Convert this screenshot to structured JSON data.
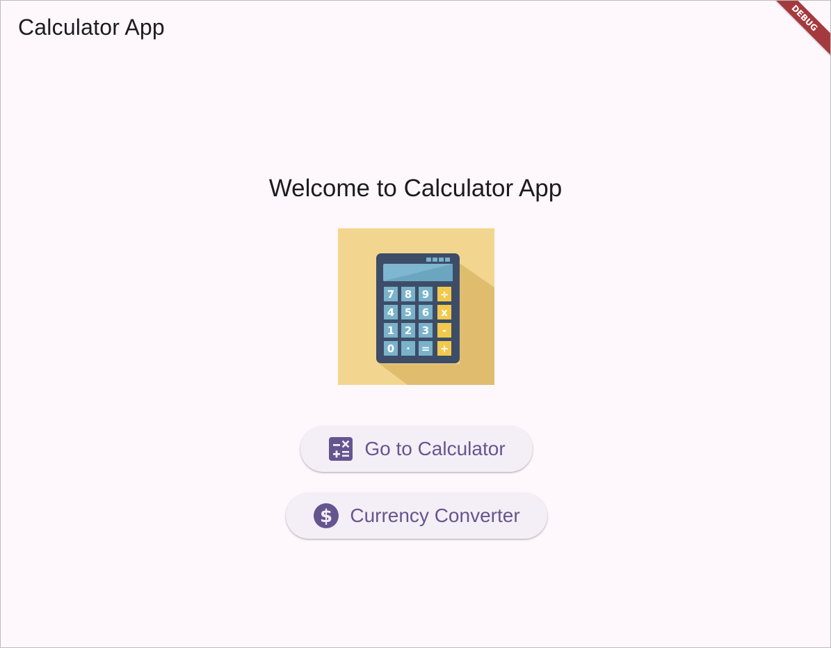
{
  "appbar": {
    "title": "Calculator App",
    "debug_label": "DEBUG"
  },
  "main": {
    "welcome": "Welcome to Calculator App",
    "hero_image": "calculator-illustration",
    "buttons": [
      {
        "label": "Go to Calculator",
        "icon": "calculate-icon"
      },
      {
        "label": "Currency Converter",
        "icon": "dollar-icon"
      }
    ]
  },
  "colors": {
    "accent": "#65558f",
    "button_bg": "#f4eff6",
    "background": "#fef7fc",
    "debug_banner": "#a53a3e"
  }
}
